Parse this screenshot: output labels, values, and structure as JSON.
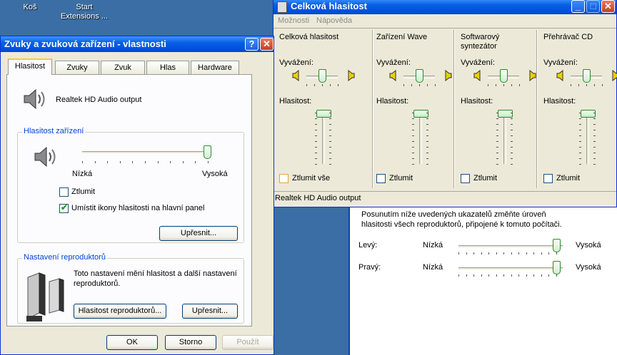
{
  "desktop": {
    "icon1_label": "Koš",
    "icon2_label": "Start\nExtensions ..."
  },
  "sounds_dialog": {
    "title": "Zvuky a zvuková zařízení - vlastnosti",
    "help_btn": "?",
    "close_btn": "✕",
    "tabs": [
      "Hlasitost",
      "Zvuky",
      "Zvuk",
      "Hlas",
      "Hardware"
    ],
    "device_name": "Realtek HD Audio output",
    "device_volume": {
      "group_title": "Hlasitost zařízení",
      "low_label": "Nízká",
      "high_label": "Vysoká",
      "level": 1.0,
      "mute_label": "Ztlumit",
      "mute_checked": false,
      "tray_label": "Umístit ikony hlasitosti na hlavní panel",
      "tray_checked": true,
      "advanced_btn": "Upřesnit..."
    },
    "speakers": {
      "group_title": "Nastavení reproduktorů",
      "description": "Toto nastavení mění hlasitost a další nastavení reproduktorů.",
      "speaker_volume_btn": "Hlasitost reproduktorů...",
      "advanced_btn": "Upřesnit..."
    },
    "ok_btn": "OK",
    "cancel_btn": "Storno",
    "apply_btn": "Použít"
  },
  "mixer": {
    "title": "Celková hlasitost",
    "menu": [
      "Možnosti",
      "Nápověda"
    ],
    "balance_label": "Vyvážení:",
    "volume_label": "Hlasitost:",
    "channels": [
      {
        "name": "Celková hlasitost",
        "mute_label": "Ztlumit vše",
        "muted": false,
        "volume": 1.0,
        "balance": 0.5
      },
      {
        "name": "Zařízení Wave",
        "mute_label": "Ztlumit",
        "muted": false,
        "volume": 1.0,
        "balance": 0.5
      },
      {
        "name": "Softwarový syntezátor",
        "mute_label": "Ztlumit",
        "muted": false,
        "volume": 1.0,
        "balance": 0.5
      },
      {
        "name": "Přehrávač CD",
        "mute_label": "Ztlumit",
        "muted": false,
        "volume": 1.0,
        "balance": 0.5
      }
    ],
    "status": "Realtek HD Audio output"
  },
  "speaker_volume": {
    "description": "Posunutím níže uvedených ukazatelů změňte úroveň hlasitosti všech reproduktorů, připojené k tomuto počítači.",
    "left_label": "Levý:",
    "right_label": "Pravý:",
    "low_label": "Nízká",
    "high_label": "Vysoká",
    "left_level": 1.0,
    "right_level": 1.0
  }
}
